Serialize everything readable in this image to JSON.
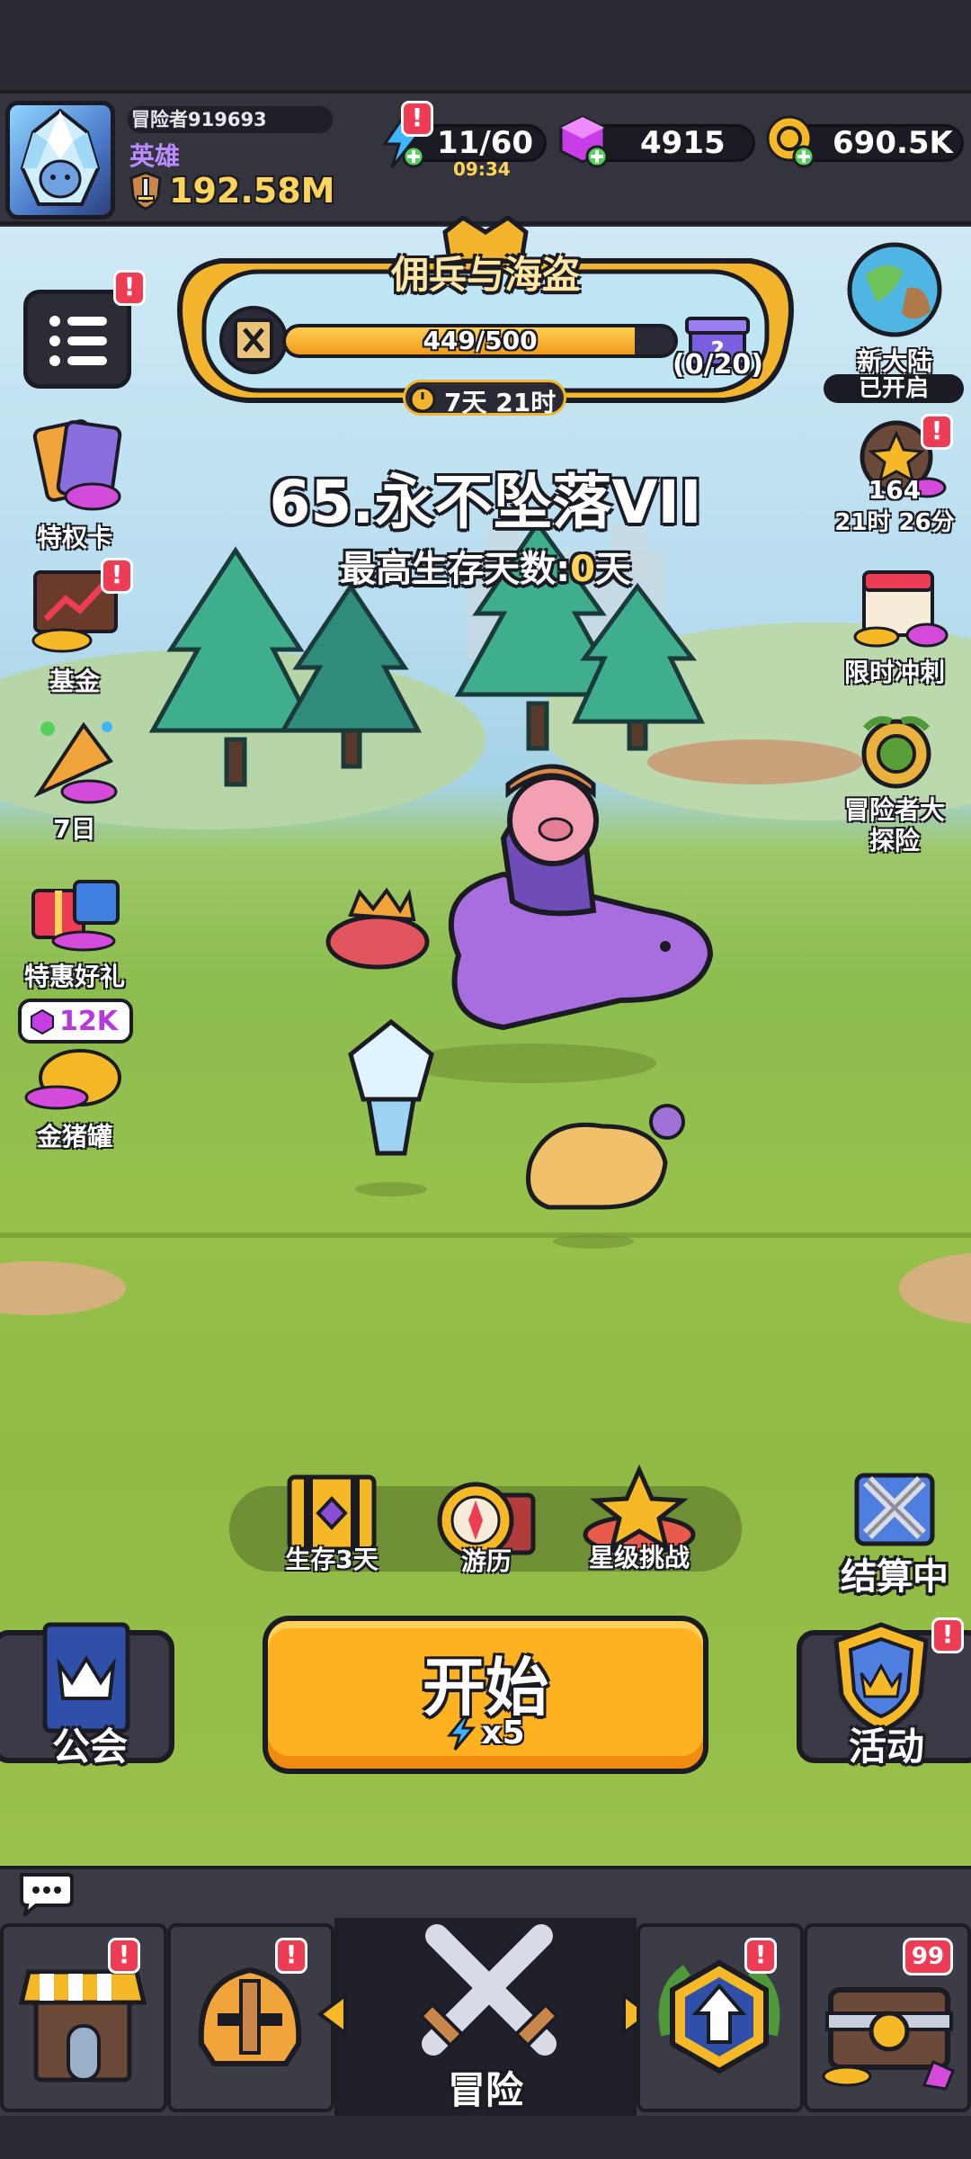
{
  "header": {
    "player_id": "冒险者919693",
    "player_rank": "英雄",
    "power": "192.58M",
    "energy": "11/60",
    "energy_timer": "09:34",
    "gems": "4915",
    "gold": "690.5K",
    "energy_badge": "!"
  },
  "banner": {
    "title": "佣兵与海盗",
    "progress_text": "449/500",
    "progress": 0.898,
    "reward_count": "(0/20)",
    "timer": "7天 21时"
  },
  "stage": {
    "title": "65.永不坠落VII",
    "survival_prefix": "最高生存天数:",
    "survival_value": "0",
    "survival_suffix": "天"
  },
  "left_side": {
    "menu_badge": "!",
    "items": [
      {
        "label": "特权卡"
      },
      {
        "label": "基金",
        "badge": "!"
      },
      {
        "label": "7日"
      },
      {
        "label": "特惠好礼"
      },
      {
        "label": "金猪罐",
        "chip": "12K"
      }
    ]
  },
  "right_side": {
    "new_continent": {
      "label": "新大陆",
      "status": "已开启"
    },
    "pass": {
      "count": "164",
      "timer": "21时 26分",
      "badge": "!"
    },
    "sprint": {
      "label": "限时冲刺"
    },
    "explore": {
      "label": "冒险者大\n探险",
      "line1": "冒险者大",
      "line2": "探险"
    }
  },
  "modes": [
    {
      "label": "生存3天"
    },
    {
      "label": "游历"
    },
    {
      "label": "星级挑战"
    }
  ],
  "settlement_label": "结算中",
  "guild_label": "公会",
  "events_label": "活动",
  "events_badge": "!",
  "start": {
    "label": "开始",
    "cost": "x5"
  },
  "nav": {
    "shop_badge": "!",
    "equip_badge": "!",
    "center_label": "冒险",
    "upgrade_badge": "!",
    "chest_badge": "99"
  },
  "colors": {
    "accent_orange": "#ffb220",
    "badge_red": "#ef3c55",
    "gold_text": "#ffd45a",
    "rank_purple": "#b98cff"
  }
}
